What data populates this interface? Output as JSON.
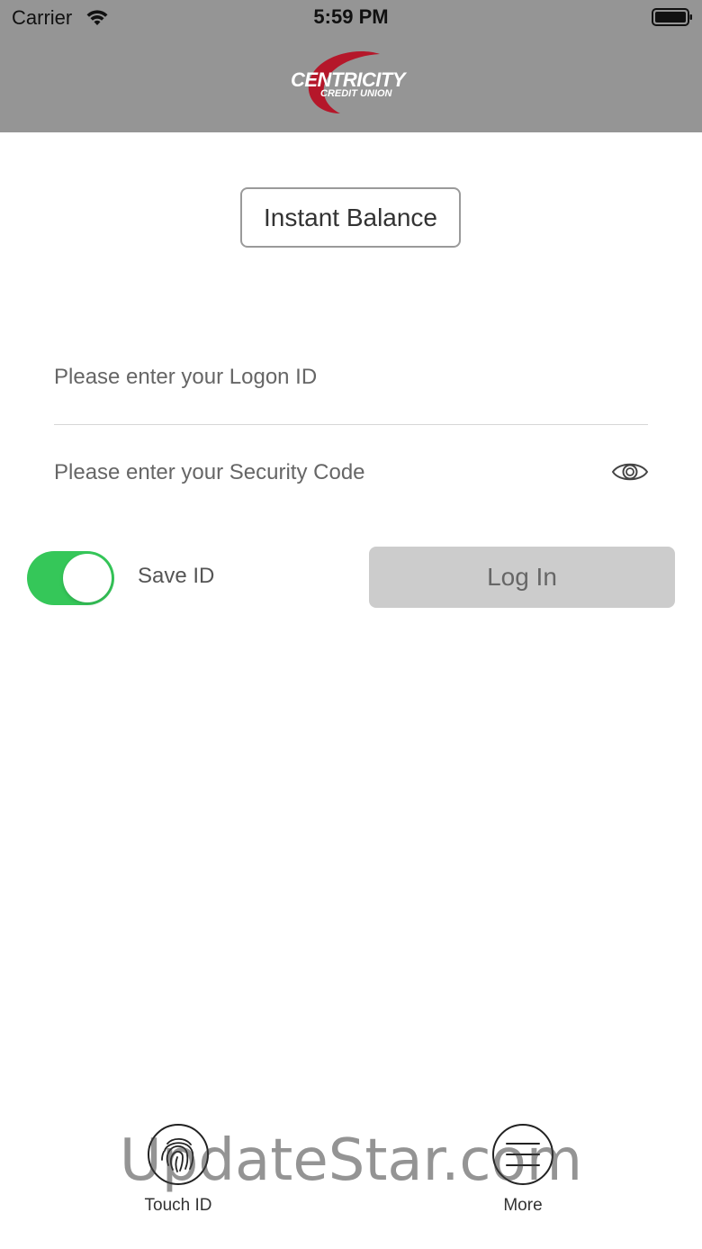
{
  "status_bar": {
    "carrier": "Carrier",
    "time": "5:59 PM",
    "wifi_icon": "wifi-icon",
    "battery_icon": "battery-full-icon"
  },
  "header": {
    "logo_main": "CENTRICITY",
    "logo_sub": "CREDIT UNION",
    "background_color": "#959595",
    "logo_accent_color": "#b5172a"
  },
  "instant_balance": {
    "label": "Instant Balance"
  },
  "login_form": {
    "logon_id_placeholder": "Please enter your Logon ID",
    "security_code_placeholder": "Please enter your Security Code",
    "show_password_icon": "eye-icon",
    "save_id_label": "Save ID",
    "save_id_enabled": true,
    "toggle_color": "#35c759",
    "login_button_label": "Log In"
  },
  "bottom_nav": {
    "touch_id_label": "Touch ID",
    "touch_id_icon": "fingerprint-icon",
    "more_label": "More",
    "more_icon": "menu-icon"
  },
  "watermark": "UpdateStar.com"
}
